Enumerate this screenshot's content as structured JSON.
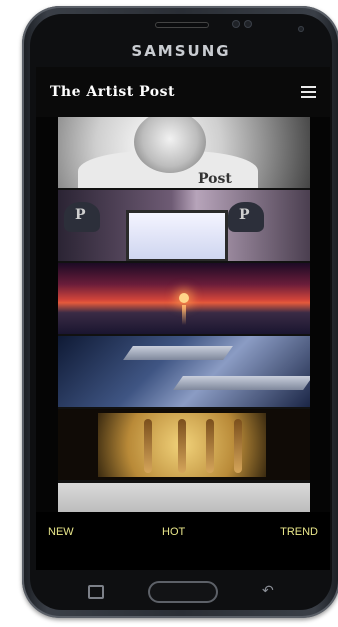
{
  "device": {
    "brand": "SAMSUNG"
  },
  "app": {
    "title": "The Artist Post",
    "menu_icon": "hamburger-menu-icon"
  },
  "feed": {
    "items": [
      {
        "kind": "photo",
        "subject": "man-in-t-shirt",
        "overlay_text": "Post"
      },
      {
        "kind": "photo",
        "subject": "laptop-with-caps",
        "overlay_text": "P"
      },
      {
        "kind": "photo",
        "subject": "sunset-over-sea"
      },
      {
        "kind": "photo",
        "subject": "stone-benches"
      },
      {
        "kind": "photo",
        "subject": "hand-x-ray"
      },
      {
        "kind": "photo",
        "subject": "partial-image"
      }
    ]
  },
  "bottom_nav": {
    "new_label": "NEW",
    "hot_label": "HOT",
    "trend_label": "TREND"
  },
  "hardware_keys": {
    "recent_icon": "recent-apps-icon",
    "home_icon": "home-button-icon",
    "back_icon": "back-arrow-icon"
  },
  "colors": {
    "nav_text": "#e8e68a",
    "appbar_bg": "#0a0a0a"
  }
}
